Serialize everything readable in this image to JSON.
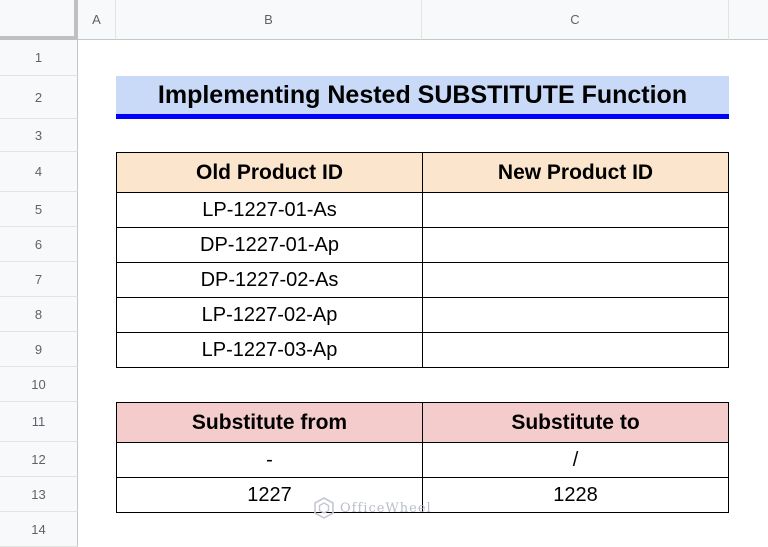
{
  "columns": [
    "A",
    "B",
    "C"
  ],
  "rows": [
    "1",
    "2",
    "3",
    "4",
    "5",
    "6",
    "7",
    "8",
    "9",
    "10",
    "11",
    "12",
    "13",
    "14"
  ],
  "title": "Implementing Nested SUBSTITUTE Function",
  "product_table": {
    "headers": [
      "Old Product ID",
      "New Product ID"
    ],
    "rows": [
      [
        "LP-1227-01-As",
        ""
      ],
      [
        "DP-1227-01-Ap",
        ""
      ],
      [
        "DP-1227-02-As",
        ""
      ],
      [
        "LP-1227-02-Ap",
        ""
      ],
      [
        "LP-1227-03-Ap",
        ""
      ]
    ]
  },
  "substitute_table": {
    "headers": [
      "Substitute from",
      "Substitute to"
    ],
    "rows": [
      [
        "-",
        "/"
      ],
      [
        "1227",
        "1228"
      ]
    ]
  },
  "watermark": "OfficeWheel",
  "colors": {
    "title_fill": "#c9daf8",
    "title_underline": "#0000ff",
    "product_header_fill": "#fce5cd",
    "substitute_header_fill": "#f4cccc"
  }
}
